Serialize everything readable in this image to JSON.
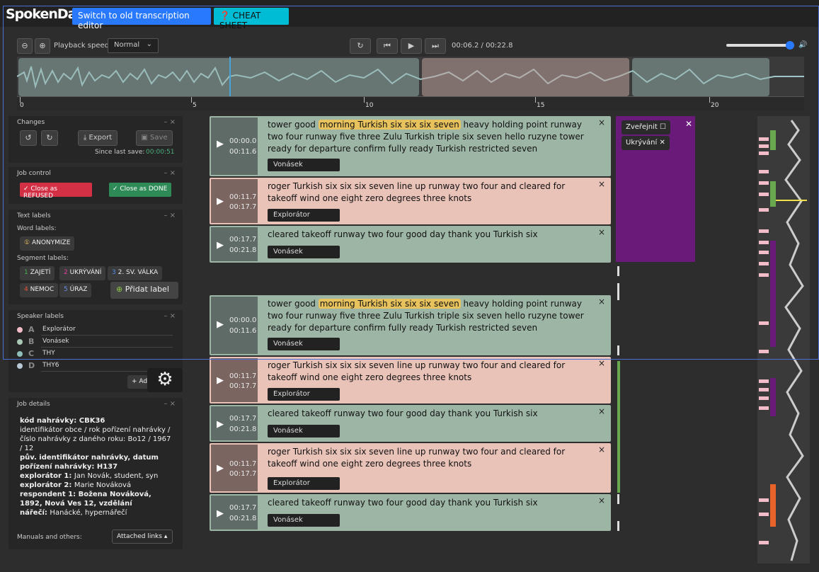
{
  "header": {
    "logo": "SpokenData",
    "old_editor_label": "Switch to old transcription editor",
    "cheat_sheet_label": "CHEAT SHEET"
  },
  "player": {
    "speed_label": "Playback speed:",
    "speed_value": "Normal",
    "time": "00:06.2 / 00:22.8",
    "volume": 0.95,
    "ruler_labels": [
      "0",
      "5",
      "10",
      "15",
      "20"
    ]
  },
  "changes": {
    "title": "Changes",
    "export_label": "Export",
    "save_label": "Save",
    "since_label": "Since last save:",
    "since_value": "00:00:51"
  },
  "job_control": {
    "title": "Job control",
    "refused_label": "✓ Close as REFUSED",
    "done_label": "✓ Close as DONE"
  },
  "text_labels": {
    "title": "Text labels",
    "word_title": "Word labels:",
    "anonymize": "ANONYMIZE",
    "segment_title": "Segment labels:",
    "segment_labels": [
      "ZAJETÍ",
      "UKRÝVÁNÍ",
      "2. SV. VÁLKA",
      "NEMOC",
      "ÚRAZ"
    ],
    "segment_nums": [
      "1",
      "2",
      "3",
      "4",
      "5"
    ],
    "add_label": "Přidat label"
  },
  "speakers": {
    "title": "Speaker labels",
    "items": [
      {
        "key": "A",
        "name": "Explorátor"
      },
      {
        "key": "B",
        "name": "Vonásek"
      },
      {
        "key": "C",
        "name": "THY"
      },
      {
        "key": "D",
        "name": "THY6"
      }
    ],
    "add_label": "+ Add"
  },
  "job_details": {
    "title": "Job details",
    "lines": [
      {
        "b": "kód nahrávky: ",
        "t": "CBK36"
      },
      {
        "b": "",
        "t": "identifikátor obce / rok pořízení nahrávky / číslo nahrávky z daného roku: Bo12 / 1967 / 12"
      },
      {
        "b": "pův. identifikátor nahrávky, datum pořízení nahrávky: ",
        "t": "H137"
      },
      {
        "b": "explorátor 1: ",
        "t": "Jan Novák, student, syn"
      },
      {
        "b": "explorátor 2: ",
        "t": "Marie Nováková"
      },
      {
        "b": "respondent 1: ",
        "t": "Božena Nováková, 1892, Nová Ves 12, vzdělání"
      },
      {
        "b": "nářečí: ",
        "t": "Hanácké, hypernářečí"
      }
    ],
    "manuals_label": "Manuals and others:",
    "links_label": "Attached links"
  },
  "label_popup": {
    "items": [
      "Zveřejnit",
      "Ukrývání"
    ]
  },
  "segments_a": [
    {
      "start": "00:00.0",
      "end": "00:11.6",
      "pre": "tower good ",
      "hl": "morning Turkish six six six seven",
      "post": " heavy holding point runway two four runway five three Zulu Turkish triple six seven hello ruzyne tower ready for departure confirm fully ready Turkish restricted seven",
      "speaker": "Vonásek"
    },
    {
      "start": "00:11.7",
      "end": "00:17.7",
      "pre": "roger Turkish six six six seven line up runway two four and cleared for takeoff wind one eight zero degrees three knots",
      "hl": "",
      "post": "",
      "speaker": "Explorátor"
    },
    {
      "start": "00:17.7",
      "end": "00:21.8",
      "pre": "cleared takeoff runway two four good day thank you Turkish six",
      "hl": "",
      "post": "",
      "speaker": "Vonásek"
    }
  ],
  "segments_b": [
    {
      "start": "00:00.0",
      "end": "00:11.6",
      "pre": "tower good ",
      "hl": "morning Turkish six six six seven",
      "post": " heavy holding point runway two four runway five three Zulu Turkish triple six seven hello ruzyne tower ready for departure confirm fully ready Turkish restricted seven",
      "speaker": "Vonásek"
    },
    {
      "start": "00:11.7",
      "end": "00:17.7",
      "pre": "roger Turkish six six six seven line up runway two four and cleared for takeoff wind one eight zero degrees three knots",
      "hl": "",
      "post": "",
      "speaker": "Explorátor"
    },
    {
      "start": "00:17.7",
      "end": "00:21.8",
      "pre": "cleared takeoff runway two four good day thank you Turkish six",
      "hl": "",
      "post": "",
      "speaker": "Vonásek"
    },
    {
      "start": "00:11.7",
      "end": "00:17.7",
      "pre": "roger Turkish six six six seven line up runway two four and cleared for takeoff wind one eight zero degrees three knots",
      "hl": "",
      "post": "",
      "speaker": "Explorátor"
    },
    {
      "start": "00:17.7",
      "end": "00:21.8",
      "pre": "cleared takeoff runway two four good day thank you Turkish six",
      "hl": "",
      "post": "",
      "speaker": "Vonásek"
    }
  ],
  "colors": {
    "green_segment": "#9db5a5",
    "pink_segment": "#e9c2b8",
    "accent_blue": "#2979ff",
    "popup_purple": "#6a1b7a"
  }
}
